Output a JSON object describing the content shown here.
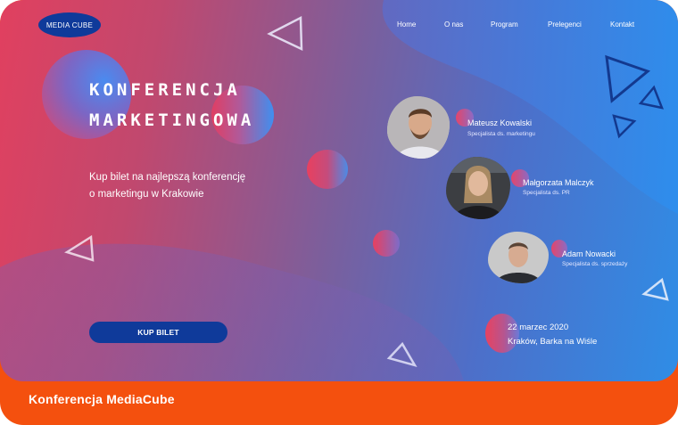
{
  "logo": {
    "text": "MEDIA CUBE"
  },
  "nav": {
    "items": [
      "Home",
      "O nas",
      "Program",
      "Prelegenci",
      "Kontakt"
    ]
  },
  "hero": {
    "title_line1": "KONFERENCJA",
    "title_line2": "MARKETINGOWA",
    "subtitle_line1": "Kup bilet na najlepszą konferencję",
    "subtitle_line2": "o marketingu w Krakowie",
    "cta_label": "KUP BILET"
  },
  "speakers": [
    {
      "name": "Mateusz Kowalski",
      "role": "Specjalista ds. marketingu"
    },
    {
      "name": "Małgorzata Malczyk",
      "role": "Specjalista ds. PR"
    },
    {
      "name": "Adam Nowacki",
      "role": "Specjalista ds. sprzedaży"
    }
  ],
  "event": {
    "date": "22 marzec 2020",
    "place": "Kraków, Barka na Wiśle"
  },
  "footer": {
    "title": "Konferencja MediaCube"
  },
  "colors": {
    "accent_blue": "#0f3a9a",
    "gradient_start": "#e1405f",
    "gradient_end": "#2f8de6",
    "footer_orange": "#f4500e"
  }
}
